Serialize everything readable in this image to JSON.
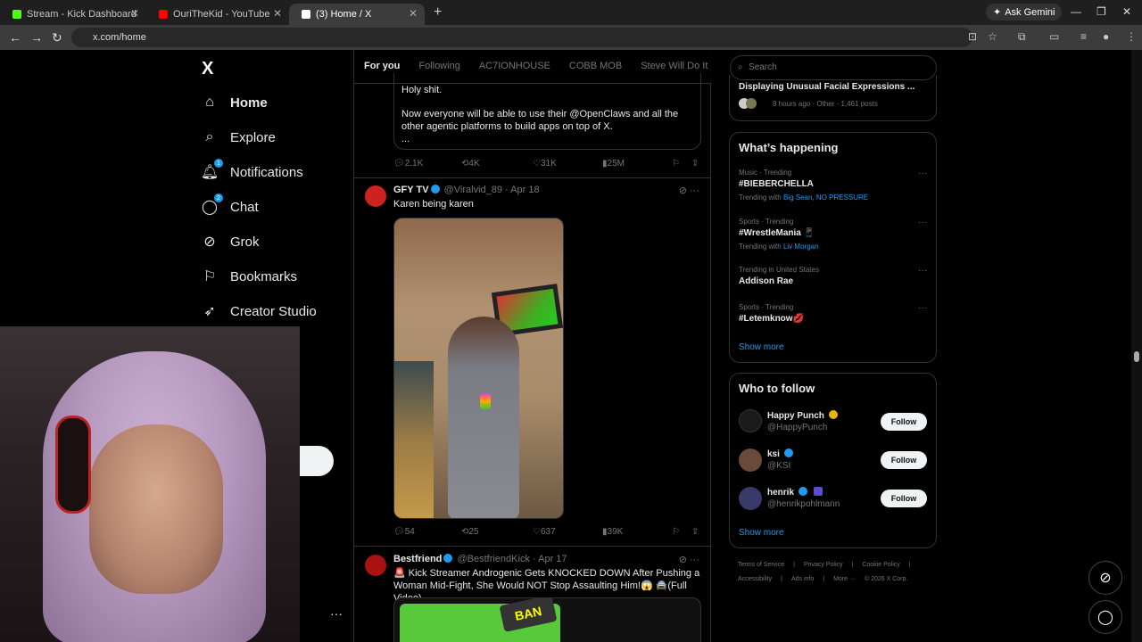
{
  "browser": {
    "tabs": [
      {
        "title": "Stream - Kick Dashboard",
        "fav_color": "#53fc18"
      },
      {
        "title": "OuriTheKid - YouTube",
        "fav_color": "#ff0000"
      },
      {
        "title": "(3) Home / X",
        "fav_color": "#ffffff"
      }
    ],
    "gemini": "Ask Gemini",
    "url": "x.com/home"
  },
  "nav": {
    "logo": "X",
    "items": [
      {
        "label": "Home",
        "icon": "home-icon"
      },
      {
        "label": "Explore",
        "icon": "search-icon"
      },
      {
        "label": "Notifications",
        "icon": "bell-icon",
        "badge": "1"
      },
      {
        "label": "Chat",
        "icon": "chat-icon",
        "badge": "2"
      },
      {
        "label": "Grok",
        "icon": "grok-icon"
      },
      {
        "label": "Bookmarks",
        "icon": "bookmark-icon"
      },
      {
        "label": "Creator Studio",
        "icon": "rocket-icon"
      }
    ]
  },
  "timeline": {
    "tabs": [
      "For you",
      "Following",
      "AC7IONHOUSE",
      "COBB MOB",
      "Steve Will Do It Loyal"
    ],
    "post0": {
      "quote_line1": "Holy shit.",
      "quote_line2": "Now everyone will be able to use their @OpenClaws and all the other agentic platforms to build apps on top of X.",
      "quote_line3": "...",
      "replies": "2.1K",
      "reposts": "4K",
      "likes": "31K",
      "views": "25M"
    },
    "post1": {
      "name": "GFY TV",
      "handle": "@Viralvid_89",
      "date": "· Apr 18",
      "text": "Karen being karen",
      "replies": "54",
      "reposts": "25",
      "likes": "637",
      "views": "39K"
    },
    "post2": {
      "name": "Bestfriend",
      "handle": "@BestfriendKick",
      "date": "· Apr 17",
      "text": "🚨 Kick Streamer Androgenic Gets KNOCKED DOWN After Pushing a Woman Mid-Fight, She Would NOT Stop Assaulting Him!😱 🚔(Full Video)",
      "thumb_text": "BAN"
    }
  },
  "right": {
    "search_placeholder": "Search",
    "top_card": {
      "title": "Displaying Unusual Facial Expressions ...",
      "meta": "8 hours ago · Other · 1,461 posts"
    },
    "happening": {
      "title": "What’s happening",
      "trends": [
        {
          "meta": "Music · Trending",
          "name": "#BIEBERCHELLA",
          "with_label": "Trending with",
          "with": "Big Sean, NO PRESSURE"
        },
        {
          "meta": "Sports · Trending",
          "name": "#WrestleMania 📱",
          "with_label": "Trending with",
          "with": "Liv Morgan"
        },
        {
          "meta": "Trending in United States",
          "name": "Addison Rae",
          "with_label": "",
          "with": ""
        },
        {
          "meta": "Sports · Trending",
          "name": "#Letemknow💋",
          "with_label": "",
          "with": ""
        }
      ],
      "show_more": "Show more"
    },
    "who_to_follow": {
      "title": "Who to follow",
      "users": [
        {
          "name": "Happy Punch",
          "handle": "@HappyPunch",
          "button": "Follow"
        },
        {
          "name": "ksi",
          "handle": "@KSI",
          "button": "Follow"
        },
        {
          "name": "henrik",
          "handle": "@henrikpohlmann",
          "button": "Follow"
        }
      ],
      "show_more": "Show more"
    },
    "footer": {
      "line1": [
        "Terms of Service",
        "|",
        "Privacy Policy",
        "|",
        "Cookie Policy",
        "|"
      ],
      "line2": [
        "Accessibility",
        "|",
        "Ads info",
        "|",
        "More ···",
        "© 2026 X Corp."
      ]
    }
  }
}
